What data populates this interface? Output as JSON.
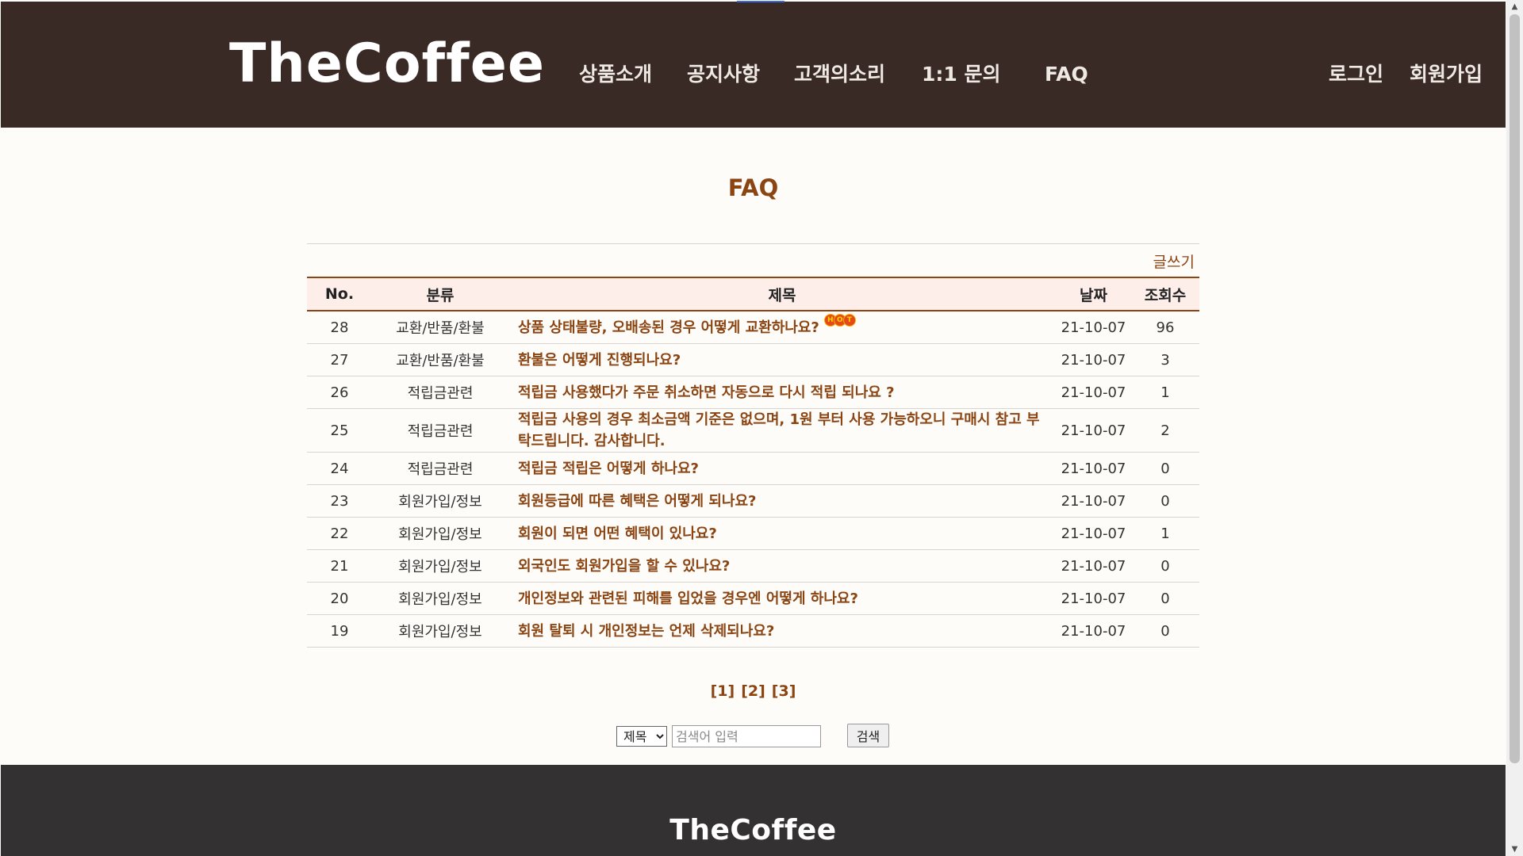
{
  "header": {
    "logo": "TheCoffee",
    "nav": [
      "상품소개",
      "공지사항",
      "고객의소리",
      "1:1 문의",
      "FAQ"
    ],
    "login": "로그인",
    "signup": "회원가입"
  },
  "main": {
    "title": "FAQ",
    "write_label": "글쓰기",
    "columns": [
      "No.",
      "분류",
      "제목",
      "날짜",
      "조회수"
    ],
    "hot_icon": "hot-icon",
    "rows": [
      {
        "no": "28",
        "category": "교환/반품/환불",
        "subject": "상품 상태불량, 오배송된 경우 어떻게 교환하나요?",
        "date": "21-10-07",
        "views": "96",
        "hot": true
      },
      {
        "no": "27",
        "category": "교환/반품/환불",
        "subject": "환불은 어떻게 진행되나요?",
        "date": "21-10-07",
        "views": "3"
      },
      {
        "no": "26",
        "category": "적립금관련",
        "subject": "적립금 사용했다가 주문 취소하면 자동으로 다시 적립 되나요 ?",
        "date": "21-10-07",
        "views": "1"
      },
      {
        "no": "25",
        "category": "적립금관련",
        "subject": "적립금 사용의 경우 최소금액 기준은 없으며, 1원 부터 사용 가능하오니 구매시 참고 부탁드립니다. 감사합니다.",
        "date": "21-10-07",
        "views": "2",
        "tall": true
      },
      {
        "no": "24",
        "category": "적립금관련",
        "subject": "적립금 적립은 어떻게 하나요?",
        "date": "21-10-07",
        "views": "0"
      },
      {
        "no": "23",
        "category": "회원가입/정보",
        "subject": "회원등급에 따른 혜택은 어떻게 되나요?",
        "date": "21-10-07",
        "views": "0"
      },
      {
        "no": "22",
        "category": "회원가입/정보",
        "subject": "회원이 되면 어떤 혜택이 있나요?",
        "date": "21-10-07",
        "views": "1"
      },
      {
        "no": "21",
        "category": "회원가입/정보",
        "subject": "외국인도 회원가입을 할 수 있나요?",
        "date": "21-10-07",
        "views": "0"
      },
      {
        "no": "20",
        "category": "회원가입/정보",
        "subject": "개인정보와 관련된 피해를 입었을 경우엔 어떻게 하나요?",
        "date": "21-10-07",
        "views": "0"
      },
      {
        "no": "19",
        "category": "회원가입/정보",
        "subject": "회원 탈퇴 시 개인정보는 언제 삭제되나요?",
        "date": "21-10-07",
        "views": "0"
      }
    ],
    "pagination": [
      "[1]",
      "[2]",
      "[3]"
    ],
    "search": {
      "field_option": "제목",
      "placeholder": "검색어 입력",
      "value": "",
      "button_label": "검색"
    }
  },
  "footer": {
    "logo": "TheCoffee"
  },
  "colors": {
    "header_bg": "#3a2a26",
    "accent": "#8b4513",
    "page_bg": "#fefcf9",
    "table_header_bg": "#fdeeea",
    "footer_bg": "#333131"
  }
}
